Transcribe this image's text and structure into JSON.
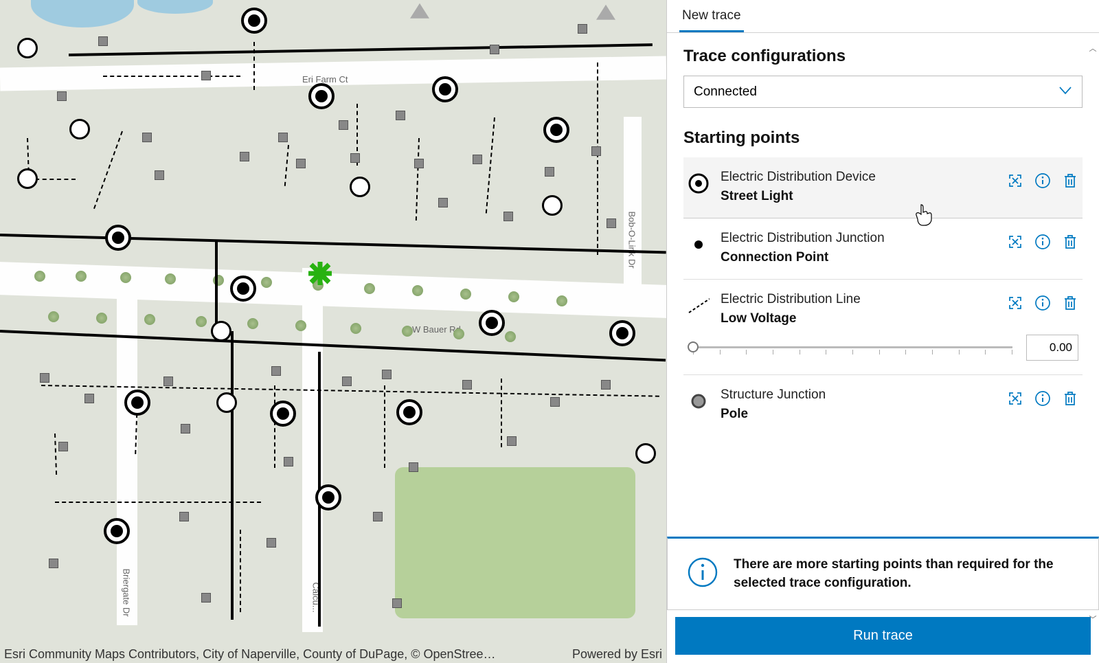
{
  "tabs": {
    "new_trace": "New trace"
  },
  "config_section": {
    "title": "Trace configurations",
    "selected": "Connected"
  },
  "sp_section": {
    "title": "Starting points",
    "items": [
      {
        "type": "Electric Distribution Device",
        "asset": "Street Light",
        "iconStyle": "ring-dot",
        "selected": true
      },
      {
        "type": "Electric Distribution Junction",
        "asset": "Connection Point",
        "iconStyle": "small-dot"
      },
      {
        "type": "Electric Distribution Line",
        "asset": "Low Voltage",
        "iconStyle": "dash-line",
        "slider_value": "0.00"
      },
      {
        "type": "Structure Junction",
        "asset": "Pole",
        "iconStyle": "gray-ring"
      }
    ]
  },
  "notice": {
    "text": "There are more starting points than required for the selected trace configuration."
  },
  "run_button": "Run trace",
  "map": {
    "roads": {
      "eri_farm": "Eri Farm Ct",
      "bauer": "W Bauer Rd",
      "bob_o_link": "Bob-O-Link Dr",
      "briergate": "Briergate Dr",
      "calcu": "Calcu..."
    },
    "attribution_left": "Esri Community Maps Contributors, City of Naperville, County of DuPage, © OpenStree…",
    "attribution_right": "Powered by Esri"
  },
  "icons": {
    "focus": "focus-icon",
    "info": "info-icon",
    "trash": "trash-icon"
  }
}
